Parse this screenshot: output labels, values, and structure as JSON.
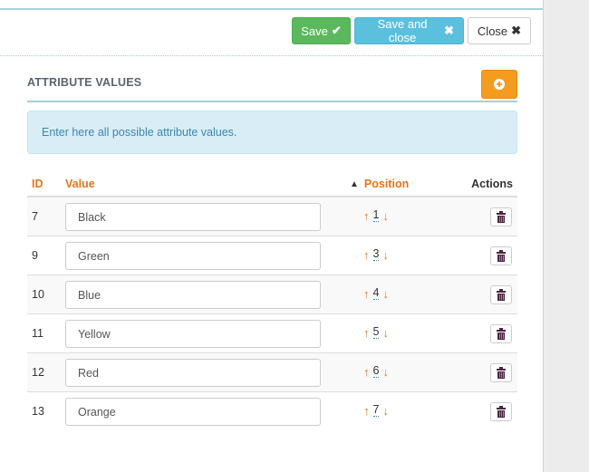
{
  "toolbar": {
    "save_label": "Save",
    "save_icon": "check-icon",
    "save_and_close_label": "Save and close",
    "save_and_close_icon": "x-icon",
    "close_label": "Close",
    "close_icon": "x-icon"
  },
  "section": {
    "title": "ATTRIBUTE VALUES",
    "add_button_icon": "plus-circle-icon"
  },
  "alert": {
    "text": "Enter here all possible attribute values."
  },
  "table": {
    "columns": {
      "id": "ID",
      "value": "Value",
      "position": "Position",
      "position_sort_icon": "chevron-up-icon",
      "actions": "Actions"
    },
    "rows": [
      {
        "id": "7",
        "value": "Black",
        "position": "1"
      },
      {
        "id": "9",
        "value": "Green",
        "position": "3"
      },
      {
        "id": "10",
        "value": "Blue",
        "position": "4"
      },
      {
        "id": "11",
        "value": "Yellow",
        "position": "5"
      },
      {
        "id": "12",
        "value": "Red",
        "position": "6"
      },
      {
        "id": "13",
        "value": "Orange",
        "position": "7"
      }
    ]
  },
  "glyphs": {
    "check": "✔",
    "x": "✖",
    "up": "🡅",
    "down": "🡇",
    "sort_up": "▲"
  },
  "colors": {
    "save": "#5cb85c",
    "save_and_close": "#5bc0de",
    "add": "#f39c1f",
    "accent_orange": "#e8751a",
    "alert_bg": "#d9edf7",
    "alert_text": "#3a87ad"
  }
}
